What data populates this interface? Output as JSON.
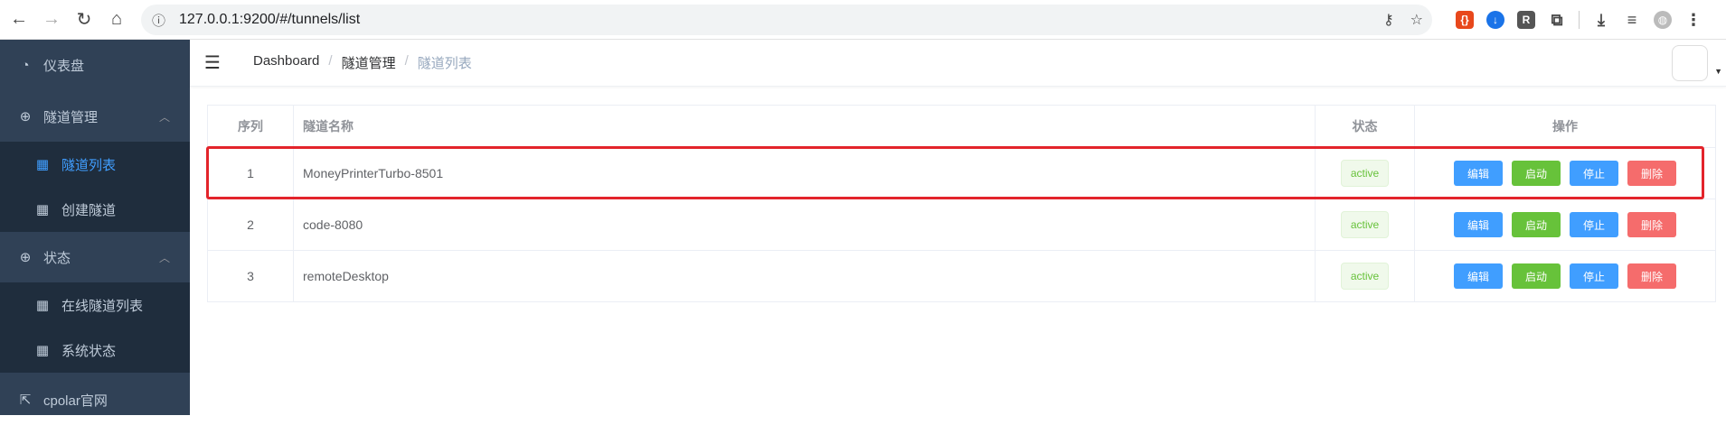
{
  "browser": {
    "url": "127.0.0.1:9200/#/tunnels/list",
    "back_icon": "arrow-left-icon",
    "forward_icon": "arrow-right-icon",
    "reload_icon": "reload-icon",
    "home_icon": "home-icon"
  },
  "sidebar": {
    "items": [
      {
        "label": "仪表盘",
        "icon": "dashboard-icon"
      },
      {
        "label": "隧道管理",
        "icon": "plus-circle-icon",
        "children": [
          {
            "label": "隧道列表",
            "active": true
          },
          {
            "label": "创建隧道"
          }
        ]
      },
      {
        "label": "状态",
        "icon": "plus-circle-icon",
        "children": [
          {
            "label": "在线隧道列表"
          },
          {
            "label": "系统状态"
          }
        ]
      },
      {
        "label": "cpolar官网",
        "icon": "external-link-icon"
      }
    ]
  },
  "breadcrumb": [
    "Dashboard",
    "隧道管理",
    "隧道列表"
  ],
  "table": {
    "headers": [
      "序列",
      "隧道名称",
      "状态",
      "操作"
    ],
    "rows": [
      {
        "index": "1",
        "name": "MoneyPrinterTurbo-8501",
        "status": "active"
      },
      {
        "index": "2",
        "name": "code-8080",
        "status": "active"
      },
      {
        "index": "3",
        "name": "remoteDesktop",
        "status": "active"
      }
    ],
    "actions": {
      "edit": "编辑",
      "start": "启动",
      "stop": "停止",
      "delete": "删除"
    }
  },
  "colors": {
    "sidebar_bg": "#304156",
    "submenu_bg": "#1f2d3d",
    "active": "#409eff",
    "success": "#67c23a",
    "danger": "#f56c6c",
    "highlight": "#e3242b"
  }
}
